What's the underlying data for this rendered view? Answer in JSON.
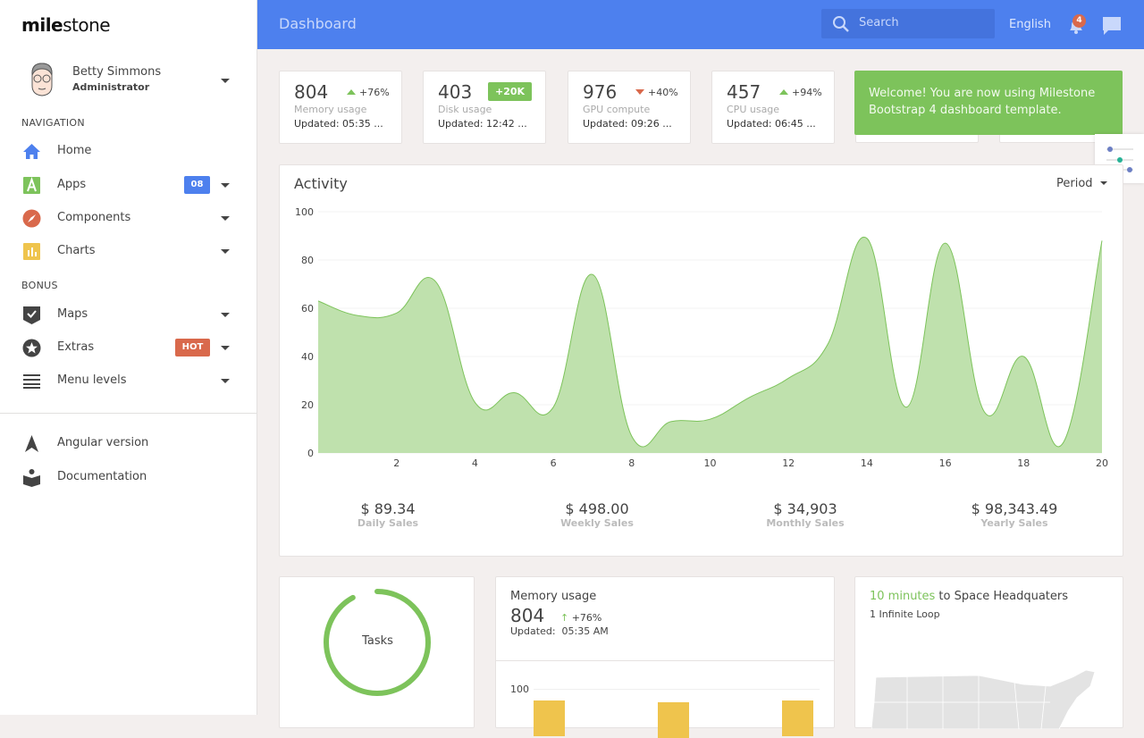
{
  "brand": {
    "logo_bold": "mile",
    "logo_rest": "stone"
  },
  "user": {
    "name": "Betty Simmons",
    "role": "Administrator"
  },
  "sidebar": {
    "section1": "NAVIGATION",
    "section2": "BONUS",
    "items": [
      {
        "label": "Home",
        "icon": "home-icon",
        "color": "#4d80ee"
      },
      {
        "label": "Apps",
        "icon": "apps-icon",
        "color": "#7dc35b",
        "badge": "08",
        "badge_color": "#4d80ee"
      },
      {
        "label": "Components",
        "icon": "compass-icon",
        "color": "#d9694c"
      },
      {
        "label": "Charts",
        "icon": "chart-icon",
        "color": "#efc44d"
      },
      {
        "label": "Maps",
        "icon": "map-check-icon",
        "color": "#444"
      },
      {
        "label": "Extras",
        "icon": "star-icon",
        "color": "#444",
        "badge": "HOT",
        "badge_color": "#d9694c"
      },
      {
        "label": "Menu levels",
        "icon": "menu-icon",
        "color": "#444"
      }
    ],
    "footer": [
      {
        "label": "Angular version",
        "icon": "angular-icon"
      },
      {
        "label": "Documentation",
        "icon": "documentation-icon"
      }
    ]
  },
  "header": {
    "title": "Dashboard",
    "search_placeholder": "Search",
    "language": "English",
    "notifications": "4"
  },
  "stats": [
    {
      "value": "804",
      "change": "+76%",
      "dir": "up",
      "name": "Memory usage",
      "updated": "Updated: 05:35 ..."
    },
    {
      "value": "403",
      "change": "+20K",
      "dir": "badge",
      "name": "Disk usage",
      "updated": "Updated: 12:42 ..."
    },
    {
      "value": "976",
      "change": "+40%",
      "dir": "down",
      "name": "GPU compute",
      "updated": "Updated: 09:26 ..."
    },
    {
      "value": "457",
      "change": "+94%",
      "dir": "up",
      "name": "CPU usage",
      "updated": "Updated: 06:45 ..."
    }
  ],
  "toast": "Welcome! You are now using Milestone Bootstrap 4 dashboard template.",
  "activity": {
    "title": "Activity",
    "period": "Period",
    "summary": [
      {
        "value": "$ 89.34",
        "label": "Daily Sales"
      },
      {
        "value": "$ 498.00",
        "label": "Weekly Sales"
      },
      {
        "value": "$ 34,903",
        "label": "Monthly Sales"
      },
      {
        "value": "$ 98,343.49",
        "label": "Yearly Sales"
      }
    ]
  },
  "chart_data": {
    "type": "area",
    "x": [
      0,
      1,
      2,
      3,
      4,
      5,
      6,
      7,
      8,
      9,
      10,
      11,
      12,
      13,
      14,
      15,
      16,
      17,
      18,
      19,
      20
    ],
    "values": [
      63,
      57,
      58,
      71,
      21,
      25,
      19,
      74,
      7,
      13,
      14,
      23,
      31,
      45,
      89,
      19,
      87,
      17,
      40,
      4,
      88
    ],
    "xticks": [
      "2",
      "4",
      "6",
      "8",
      "10",
      "12",
      "14",
      "16",
      "18",
      "20"
    ],
    "yticks": [
      "0",
      "20",
      "40",
      "60",
      "80",
      "100"
    ],
    "xlim": [
      0,
      20
    ],
    "ylim": [
      0,
      100
    ],
    "grid": true,
    "color": "#7dc35b"
  },
  "tasks": {
    "label": "Tasks",
    "progress": 0.92
  },
  "memory": {
    "title": "Memory usage",
    "value": "804",
    "change": "+76%",
    "updated_label": "Updated:",
    "updated_time": "05:35 AM",
    "ytick": "100"
  },
  "location": {
    "highlight": "10 minutes",
    "rest": " to Space Headquaters",
    "address": "1 Infinite Loop"
  }
}
